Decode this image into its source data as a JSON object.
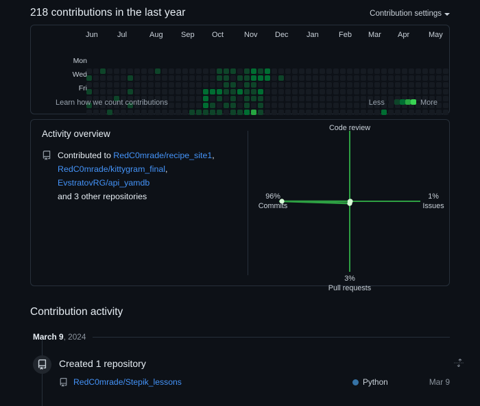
{
  "header": {
    "title": "218 contributions in the last year",
    "settings_label": "Contribution settings",
    "caret_icon": "chevron-down-icon"
  },
  "contribution_graph": {
    "months": [
      "Jun",
      "Jul",
      "Aug",
      "Sep",
      "Oct",
      "Nov",
      "Dec",
      "Jan",
      "Feb",
      "Mar",
      "Apr",
      "May"
    ],
    "day_labels": [
      "Mon",
      "Wed",
      "Fri"
    ],
    "learn_link": "Learn how we count contributions",
    "legend": {
      "less_label": "Less",
      "more_label": "More",
      "colors": [
        "#161b22",
        "#0e4429",
        "#006d32",
        "#26a641",
        "#39d353"
      ]
    },
    "level_colors": [
      "#161b22",
      "#0e4429",
      "#006d32",
      "#26a641",
      "#39d353"
    ],
    "weeks": 53,
    "days_per_week": 7,
    "levels": [
      [
        0,
        1,
        0,
        1,
        0,
        1,
        0
      ],
      [
        0,
        0,
        0,
        0,
        0,
        0,
        0
      ],
      [
        1,
        0,
        0,
        0,
        0,
        0,
        0
      ],
      [
        0,
        0,
        0,
        0,
        0,
        0,
        1
      ],
      [
        0,
        0,
        0,
        0,
        1,
        0,
        0
      ],
      [
        0,
        0,
        0,
        0,
        0,
        0,
        0
      ],
      [
        0,
        1,
        0,
        1,
        0,
        1,
        0
      ],
      [
        0,
        0,
        0,
        0,
        0,
        0,
        0
      ],
      [
        0,
        0,
        0,
        0,
        0,
        0,
        0
      ],
      [
        0,
        0,
        0,
        0,
        0,
        0,
        0
      ],
      [
        1,
        0,
        0,
        0,
        0,
        0,
        0
      ],
      [
        0,
        0,
        0,
        0,
        0,
        0,
        0
      ],
      [
        0,
        0,
        0,
        0,
        0,
        0,
        0
      ],
      [
        0,
        0,
        0,
        0,
        0,
        0,
        0
      ],
      [
        0,
        0,
        0,
        0,
        0,
        0,
        0
      ],
      [
        0,
        0,
        0,
        0,
        0,
        0,
        1
      ],
      [
        0,
        0,
        0,
        0,
        0,
        0,
        1
      ],
      [
        0,
        0,
        0,
        2,
        2,
        2,
        1
      ],
      [
        0,
        0,
        0,
        2,
        0,
        1,
        1
      ],
      [
        1,
        1,
        0,
        2,
        1,
        0,
        1
      ],
      [
        1,
        1,
        1,
        1,
        0,
        1,
        0
      ],
      [
        1,
        0,
        1,
        1,
        1,
        1,
        1
      ],
      [
        0,
        1,
        0,
        2,
        0,
        0,
        1
      ],
      [
        1,
        1,
        1,
        1,
        1,
        1,
        2
      ],
      [
        2,
        2,
        1,
        1,
        1,
        0,
        3
      ],
      [
        1,
        2,
        0,
        2,
        1,
        1,
        1
      ],
      [
        2,
        2,
        0,
        0,
        0,
        0,
        0
      ],
      [
        0,
        0,
        0,
        0,
        0,
        0,
        0
      ],
      [
        0,
        1,
        0,
        0,
        0,
        0,
        0
      ],
      [
        0,
        0,
        0,
        0,
        0,
        0,
        0
      ],
      [
        0,
        0,
        0,
        0,
        0,
        0,
        0
      ],
      [
        0,
        0,
        0,
        0,
        0,
        0,
        0
      ],
      [
        0,
        0,
        0,
        0,
        0,
        0,
        0
      ],
      [
        0,
        0,
        0,
        0,
        0,
        0,
        0
      ],
      [
        0,
        0,
        0,
        0,
        0,
        0,
        0
      ],
      [
        0,
        0,
        0,
        0,
        0,
        0,
        0
      ],
      [
        0,
        0,
        0,
        0,
        0,
        0,
        0
      ],
      [
        0,
        0,
        0,
        0,
        0,
        0,
        0
      ],
      [
        0,
        0,
        0,
        0,
        0,
        0,
        0
      ],
      [
        0,
        0,
        0,
        0,
        0,
        0,
        0
      ],
      [
        0,
        0,
        0,
        0,
        0,
        0,
        0
      ],
      [
        0,
        0,
        0,
        0,
        0,
        0,
        0
      ],
      [
        0,
        0,
        0,
        0,
        0,
        0,
        0
      ],
      [
        0,
        0,
        0,
        0,
        0,
        0,
        2
      ],
      [
        0,
        0,
        0,
        0,
        0,
        0,
        0
      ],
      [
        0,
        0,
        0,
        0,
        0,
        0,
        0
      ],
      [
        0,
        0,
        0,
        0,
        0,
        0,
        0
      ],
      [
        0,
        0,
        0,
        0,
        0,
        0,
        0
      ],
      [
        0,
        0,
        0,
        0,
        0,
        0,
        0
      ],
      [
        0,
        0,
        0,
        0,
        0,
        0,
        0
      ],
      [
        0,
        0,
        0,
        0,
        0,
        0,
        0
      ],
      [
        0,
        0,
        0,
        0,
        0,
        0,
        0
      ],
      [
        0,
        0,
        0,
        0,
        0,
        0,
        0
      ]
    ]
  },
  "activity_overview": {
    "title": "Activity overview",
    "icon": "repo-icon",
    "prefix": "Contributed to ",
    "repos": [
      "RedC0mrade/recipe_site1",
      "RedC0mrade/kittygram_final",
      "EvstratovRG/api_yamdb"
    ],
    "separators": [
      ",",
      ","
    ],
    "suffix": "and 3 other repositories"
  },
  "chart_data": {
    "type": "radar",
    "title": "",
    "axes": [
      "Code review",
      "Issues",
      "Pull requests",
      "Commits"
    ],
    "categories": [
      "Code review",
      "Issues",
      "Pull requests",
      "Commits"
    ],
    "values": [
      0,
      1,
      3,
      96
    ],
    "value_labels": [
      "",
      "1%",
      "3%",
      "96%"
    ],
    "axis_label_positions": [
      "top",
      "right",
      "bottom",
      "left"
    ],
    "unit": "%",
    "range": [
      0,
      100
    ],
    "grid": false,
    "legend": "none",
    "line_color": "#2ea043",
    "fill_color": "#2ea04333",
    "point_color": "#d9fdd9",
    "axis_color": "#2ea043"
  },
  "contribution_activity": {
    "title": "Contribution activity",
    "date_group": {
      "month_day": "March 9",
      "year": ", 2024"
    },
    "entry": {
      "badge_icon": "repo-icon",
      "heading": "Created 1 repository",
      "repo_icon": "repo-icon",
      "repo_name": "RedC0mrade/Stepik_lessons",
      "language": "Python",
      "language_color": "#3572A5",
      "date": "Mar 9",
      "fold_icon": "fold-icon"
    }
  }
}
